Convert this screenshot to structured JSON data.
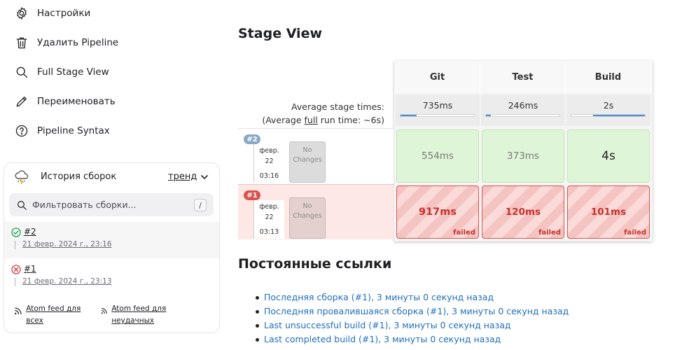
{
  "sidebar": {
    "tasks": [
      {
        "label": "Настройки",
        "icon": "gear-icon"
      },
      {
        "label": "Удалить Pipeline",
        "icon": "trash-icon"
      },
      {
        "label": "Full Stage View",
        "icon": "search-icon"
      },
      {
        "label": "Переименовать",
        "icon": "pencil-icon"
      },
      {
        "label": "Pipeline Syntax",
        "icon": "help-circle-icon"
      }
    ]
  },
  "build_history": {
    "title": "История сборок",
    "trend_label": "тренд",
    "filter_placeholder": "Фильтровать сборки...",
    "filter_shortcut": "/",
    "builds": [
      {
        "number": "#2",
        "date": "21 февр. 2024 г., 23:16",
        "status": "success",
        "status_color": "#1ea446"
      },
      {
        "number": "#1",
        "date": "21 февр. 2024 г., 23:13",
        "status": "failed",
        "status_color": "#d63a3a"
      }
    ],
    "feeds": {
      "all": "Atom feed для всех",
      "failed": "Atom feed для неудачных"
    }
  },
  "stage_view": {
    "title": "Stage View",
    "average_label": "Average stage times:",
    "average_full_prefix": "(Average ",
    "average_full_link": "full",
    "average_full_suffix": " run time: ~6s)",
    "stages": [
      {
        "name": "Git",
        "avg": "735ms",
        "avg_fill": 0.22
      },
      {
        "name": "Test",
        "avg": "246ms",
        "avg_fill": 0.07
      },
      {
        "name": "Build",
        "avg": "2s",
        "avg_fill": 0.7
      }
    ],
    "runs": [
      {
        "badge": "#2",
        "date_month": "февр.",
        "date_day": "22",
        "time": "03:16",
        "changes": "No Changes",
        "status": "success",
        "badge_color": "#8aa8c8",
        "cells": [
          {
            "value": "554ms"
          },
          {
            "value": "373ms"
          },
          {
            "value": "4s"
          }
        ]
      },
      {
        "badge": "#1",
        "date_month": "февр.",
        "date_day": "22",
        "time": "03:13",
        "changes": "No Changes",
        "status": "failed",
        "badge_color": "#d9534f",
        "cells": [
          {
            "value": "917ms",
            "label": "failed"
          },
          {
            "value": "120ms",
            "label": "failed"
          },
          {
            "value": "101ms",
            "label": "failed"
          }
        ]
      }
    ]
  },
  "permalinks": {
    "title": "Постоянные ссылки",
    "items": [
      "Последняя сборка (#1), 3 минуты 0 секунд назад",
      "Последняя провалившаяся сборка (#1), 3 минуты 0 секунд назад",
      "Last unsuccessful build (#1), 3 минуты 0 секунд назад",
      "Last completed build (#1), 3 минуты 0 секунд назад"
    ]
  },
  "colors": {
    "success_bg": "#dff5d7",
    "failed_bg": "#f4c4c2",
    "failed_text": "#c9302c",
    "link": "#1f6fbf"
  }
}
